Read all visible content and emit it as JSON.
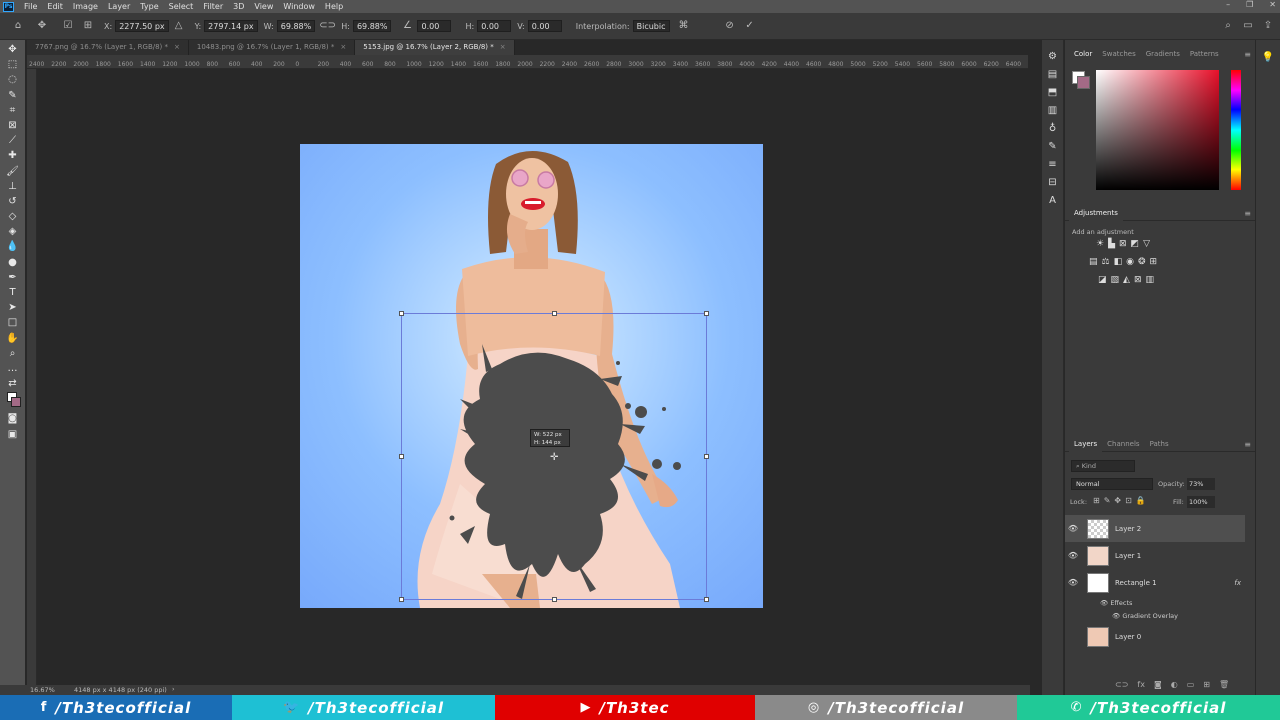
{
  "menubar": {
    "logo": "Ps",
    "items": [
      "File",
      "Edit",
      "Image",
      "Layer",
      "Type",
      "Select",
      "Filter",
      "3D",
      "View",
      "Window",
      "Help"
    ]
  },
  "options": {
    "x_label": "X:",
    "x_value": "2277.50 px",
    "y_label": "Y:",
    "y_value": "2797.14 px",
    "w_label": "W:",
    "w_value": "69.88%",
    "h_label": "H:",
    "h_value": "69.88%",
    "angle_value": "0.00",
    "hskew_label": "H:",
    "hskew_value": "0.00",
    "vskew_label": "V:",
    "vskew_value": "0.00",
    "interp_label": "Interpolation:",
    "interp_value": "Bicubic"
  },
  "tabs": [
    {
      "label": "7767.png @ 16.7% (Layer 1, RGB/8) *"
    },
    {
      "label": "10483.png @ 16.7% (Layer 1, RGB/8) *"
    },
    {
      "label": "5153.jpg @ 16.7% (Layer 2, RGB/8) *",
      "active": true
    }
  ],
  "ruler_ticks": [
    "2400",
    "2200",
    "2000",
    "1800",
    "1600",
    "1400",
    "1200",
    "1000",
    "800",
    "600",
    "400",
    "200",
    "0",
    "200",
    "400",
    "600",
    "800",
    "1000",
    "1200",
    "1400",
    "1600",
    "1800",
    "2000",
    "2200",
    "2400",
    "2600",
    "2800",
    "3000",
    "3200",
    "3400",
    "3600",
    "3800",
    "4000",
    "4200",
    "4400",
    "4600",
    "4800",
    "5000",
    "5200",
    "5400",
    "5600",
    "5800",
    "6000",
    "6200",
    "6400"
  ],
  "tooltip": {
    "w": "W: 522 px",
    "h": "H: 144 px"
  },
  "status": {
    "zoom": "16.67%",
    "doc_info": "4148 px x 4148 px (240 ppi)"
  },
  "panels": {
    "color_tabs": [
      "Color",
      "Swatches",
      "Gradients",
      "Patterns"
    ],
    "adjustments_title": "Adjustments",
    "adjustments_hint": "Add an adjustment",
    "layers_tabs": [
      "Layers",
      "Channels",
      "Paths"
    ],
    "kind_placeholder": "Kind",
    "blend_mode": "Normal",
    "opacity_label": "Opacity:",
    "opacity_value": "73%",
    "lock_label": "Lock:",
    "fill_label": "Fill:",
    "fill_value": "100%",
    "layers": [
      {
        "name": "Layer 2",
        "selected": true
      },
      {
        "name": "Layer 1"
      },
      {
        "name": "Rectangle 1",
        "fx": "fx"
      },
      {
        "name": "Layer 0"
      }
    ],
    "effects_label": "Effects",
    "gradient_overlay_label": "Gradient Overlay"
  },
  "social": [
    {
      "icon": "facebook-icon",
      "glyph": "f",
      "label": "/Th3tecofficial",
      "color": "#1a6db5"
    },
    {
      "icon": "twitter-icon",
      "glyph": "🐦",
      "label": "/Th3tecofficial",
      "color": "#1ec0d4"
    },
    {
      "icon": "youtube-icon",
      "glyph": "▶",
      "label": "/Th3tec",
      "color": "#e00000"
    },
    {
      "icon": "instagram-icon",
      "glyph": "◎",
      "label": "/Th3tecofficial",
      "color": "#8a8a8a"
    },
    {
      "icon": "whatsapp-icon",
      "glyph": "✆",
      "label": "/Th3tecofficial",
      "color": "#20c997"
    }
  ]
}
